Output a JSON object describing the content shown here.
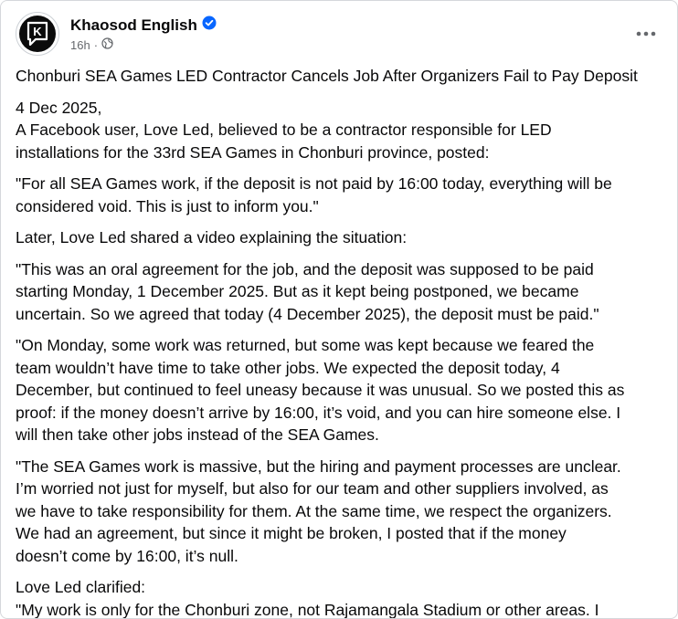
{
  "post": {
    "author": "Khaosod English",
    "time": "16h",
    "separator": "·",
    "logo_letter": "K",
    "icons": [
      "verified-badge-icon",
      "globe-icon",
      "more-options-icon"
    ],
    "accent_color": "#0866ff",
    "paragraphs": [
      [
        "Chonburi SEA Games LED Contractor Cancels Job After Organizers Fail to Pay Deposit"
      ],
      [
        "4 Dec 2025,",
        "A Facebook user, Love Led, believed to be a contractor responsible for LED",
        "installations for the 33rd SEA Games in Chonburi province, posted:"
      ],
      [
        "\"For all SEA Games work, if the deposit is not paid by 16:00 today, everything will be",
        "considered void. This is just to inform you.\""
      ],
      [
        "Later, Love Led shared a video explaining the situation:"
      ],
      [
        "\"This was an oral agreement for the job, and the deposit was supposed to be paid",
        "starting Monday, 1 December 2025. But as it kept being postponed, we became",
        "uncertain. So we agreed that today (4 December 2025), the deposit must be paid.\""
      ],
      [
        "\"On Monday, some work was returned, but some was kept because we feared the",
        "team wouldn’t have time to take other jobs. We expected the deposit today, 4",
        "December, but continued to feel uneasy because it was unusual. So we posted this as",
        "proof: if the money doesn’t arrive by 16:00, it’s void, and you can hire someone else. I",
        "will then take other jobs instead of the SEA Games."
      ],
      [
        "\"The SEA Games work is massive, but the hiring and payment processes are unclear.",
        "I’m worried not just for myself, but also for our team and other suppliers involved, as",
        "we have to take responsibility for them. At the same time, we respect the organizers.",
        "We had an agreement, but since it might be broken, I posted that if the money",
        "doesn’t come by 16:00, it’s null."
      ],
      [
        "Love Led clarified:",
        "\"My work is only for the Chonburi zone, not Rajamangala Stadium or other areas. I"
      ]
    ]
  }
}
